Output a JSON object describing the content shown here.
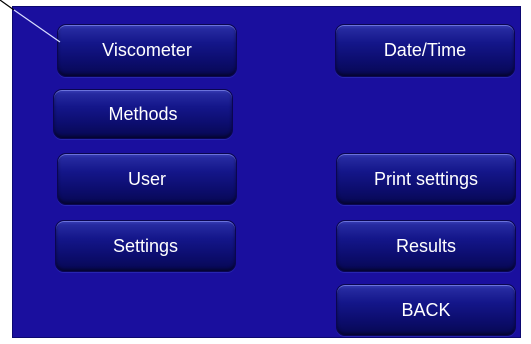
{
  "menu": {
    "left": {
      "viscometer": "Viscometer",
      "methods": "Methods",
      "user": "User",
      "settings": "Settings"
    },
    "right": {
      "datetime": "Date/Time",
      "print_settings": "Print settings",
      "results": "Results",
      "back": "BACK"
    }
  },
  "colors": {
    "screen_background": "#1a0f9e",
    "button_top": "#3a3fb8",
    "button_bottom": "#070852",
    "text": "#ffffff"
  },
  "icons": {
    "pointer": "callout-line"
  }
}
